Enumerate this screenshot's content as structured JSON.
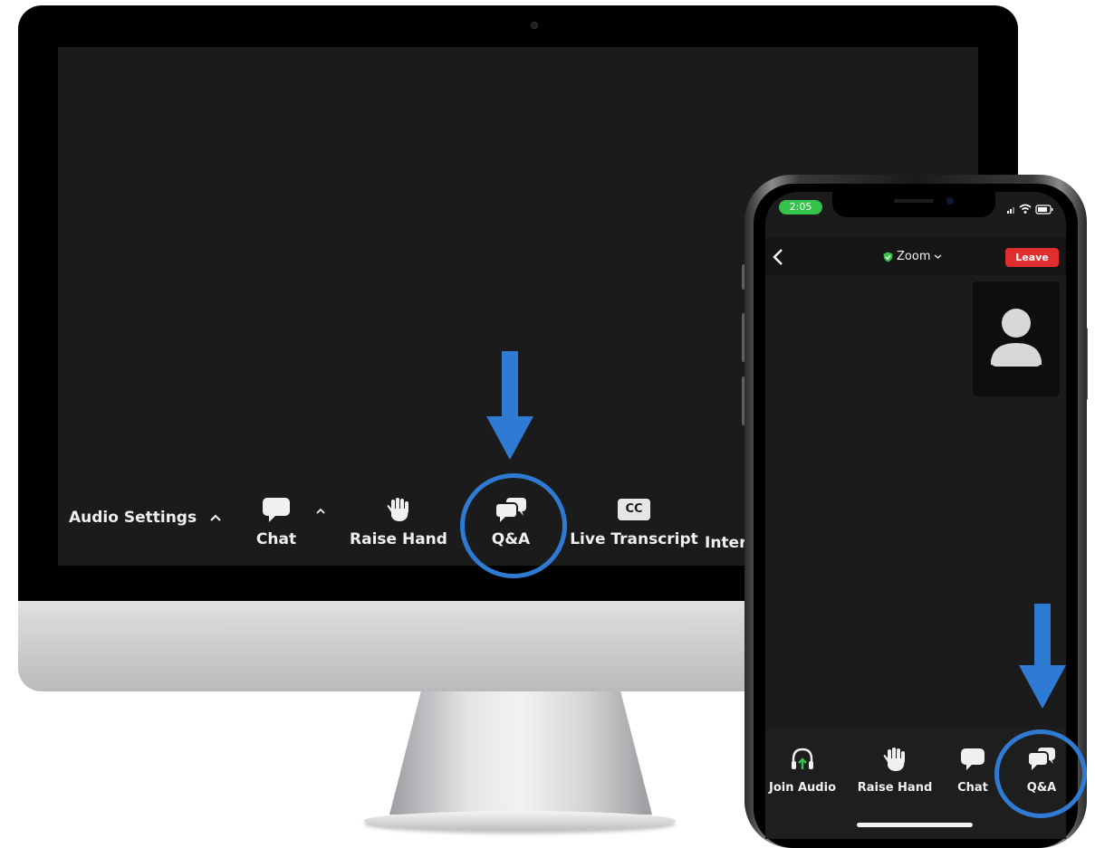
{
  "desktop": {
    "toolbar": {
      "audio_settings_label": "Audio Settings",
      "chat_label": "Chat",
      "raise_hand_label": "Raise Hand",
      "qa_label": "Q&A",
      "cc_badge": "CC",
      "live_transcript_label": "Live Transcript",
      "interpretation_label": "Inter"
    }
  },
  "phone": {
    "status_time": "2:05",
    "meeting_title": "Zoom",
    "leave_label": "Leave",
    "toolbar": {
      "join_audio_label": "Join Audio",
      "raise_hand_label": "Raise Hand",
      "chat_label": "Chat",
      "qa_label": "Q&A"
    }
  },
  "colors": {
    "highlight_blue": "#2f7bd4",
    "leave_red": "#e02e2e",
    "status_green": "#33c24a"
  }
}
